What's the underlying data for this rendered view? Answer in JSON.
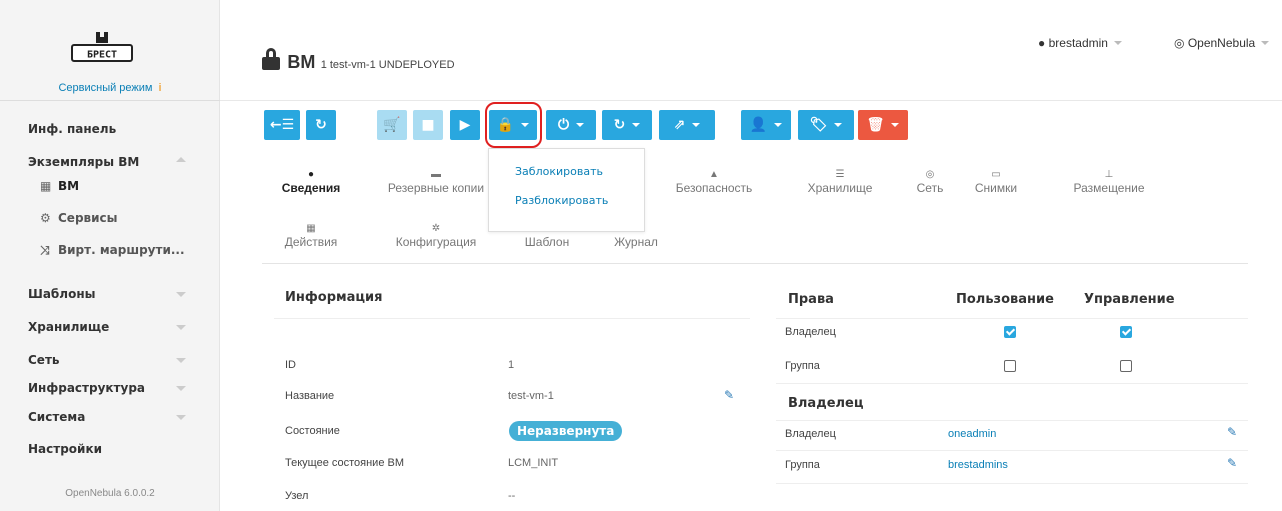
{
  "sidebar": {
    "brand_mode": "Сервисный режим",
    "brand_logo_text": "БРЕСТ",
    "items": [
      {
        "label": "Инф. панель"
      },
      {
        "label": "Экземпляры ВМ"
      },
      {
        "label": "ВМ"
      },
      {
        "label": "Сервисы"
      },
      {
        "label": "Вирт. маршрути..."
      },
      {
        "label": "Шаблоны"
      },
      {
        "label": "Хранилище"
      },
      {
        "label": "Сеть"
      },
      {
        "label": "Инфраструктура"
      },
      {
        "label": "Система"
      },
      {
        "label": "Настройки"
      }
    ],
    "version": "OpenNebula 6.0.0.2"
  },
  "header": {
    "title": "ВМ",
    "subtitle": "1 test-vm-1 UNDEPLOYED",
    "user": "brestadmin",
    "zone": "OpenNebula"
  },
  "dropdown": {
    "lock": "Заблокировать",
    "unlock": "Разблокировать"
  },
  "tabs": [
    {
      "label": "Сведения"
    },
    {
      "label": "Резервные копии"
    },
    {
      "label": "Безопасность"
    },
    {
      "label": "Хранилище"
    },
    {
      "label": "Сеть"
    },
    {
      "label": "Снимки"
    },
    {
      "label": "Размещение"
    },
    {
      "label": "Действия"
    },
    {
      "label": "Конфигурация"
    },
    {
      "label": "Шаблон"
    },
    {
      "label": "Журнал"
    }
  ],
  "info": {
    "title": "Информация",
    "rows": [
      {
        "label": "ID",
        "value": "1"
      },
      {
        "label": "Название",
        "value": "test-vm-1"
      },
      {
        "label": "Состояние",
        "value": "Неразвернута"
      },
      {
        "label": "Текущее состояние ВМ",
        "value": "LCM_INIT"
      },
      {
        "label": "Узел",
        "value": "--"
      }
    ]
  },
  "perms": {
    "title": "Права",
    "col_use": "Пользование",
    "col_manage": "Управление",
    "rows": [
      {
        "label": "Владелец",
        "use": true,
        "manage": true
      },
      {
        "label": "Группа",
        "use": false,
        "manage": false
      }
    ]
  },
  "owner": {
    "title": "Владелец",
    "rows": [
      {
        "label": "Владелец",
        "value": "oneadmin"
      },
      {
        "label": "Группа",
        "value": "brestadmins"
      }
    ]
  },
  "colors": {
    "accent": "#29a7df",
    "danger": "#ec5840",
    "link": "#0a7fb6",
    "highlight": "#e02020"
  }
}
